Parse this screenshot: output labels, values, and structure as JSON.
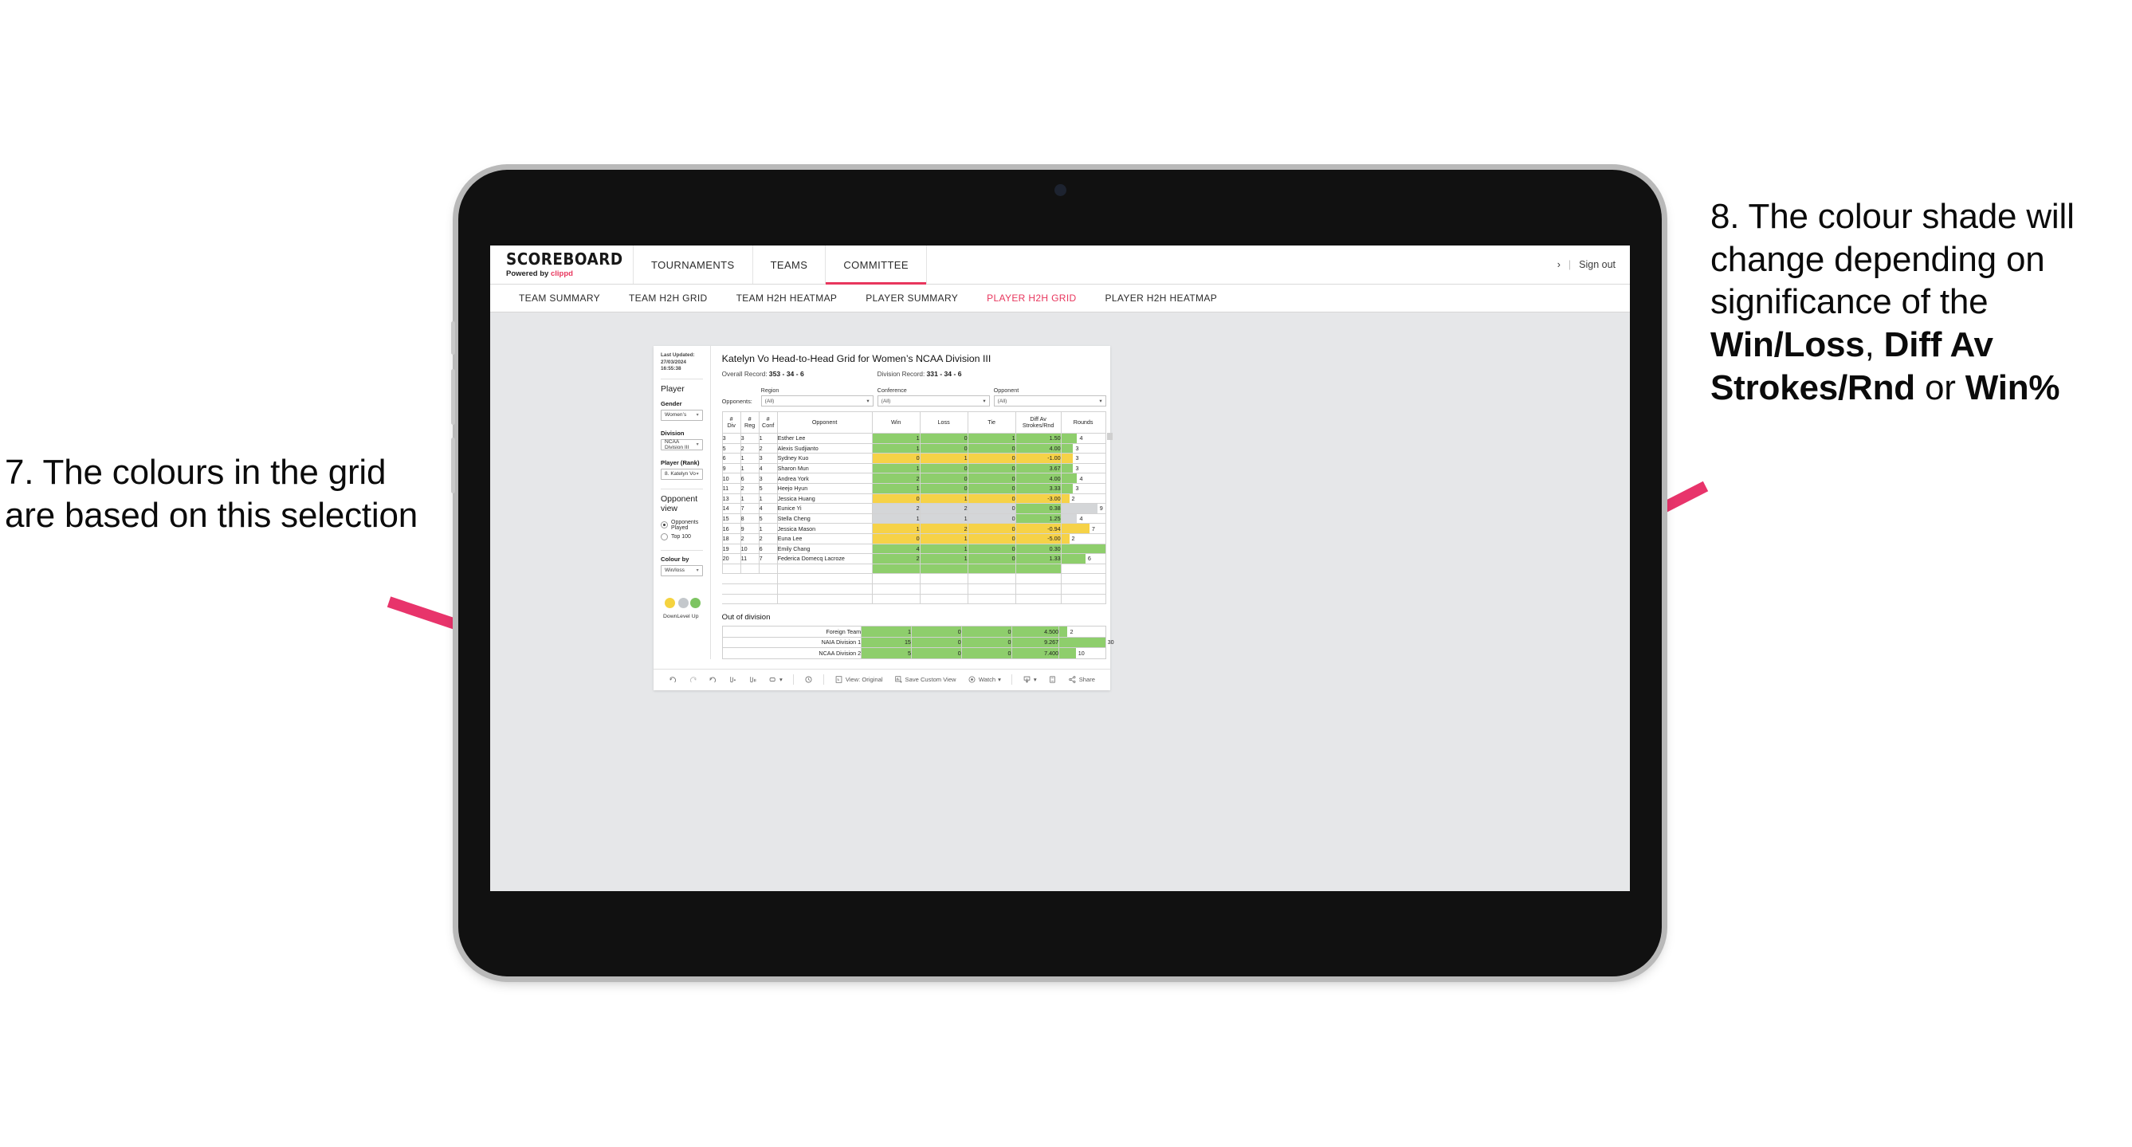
{
  "annotations": {
    "left": {
      "id": "annot-7",
      "text": "7. The colours in the grid are based on this selection"
    },
    "right": {
      "id": "annot-8",
      "prefix": "8. The colour shade will change depending on significance of the ",
      "b1": "Win/Loss",
      "mid1": ", ",
      "b2": "Diff Av Strokes/Rnd",
      "mid2": " or ",
      "b3": "Win%"
    },
    "arrow_color": "#e8346b"
  },
  "app": {
    "logo": {
      "main": "SCOREBOARD",
      "powered": "Powered by ",
      "brand": "clippd"
    },
    "nav": [
      {
        "label": "TOURNAMENTS",
        "active": false
      },
      {
        "label": "TEAMS",
        "active": false
      },
      {
        "label": "COMMITTEE",
        "active": true
      }
    ],
    "header_right": {
      "chevron": "›",
      "sep": "|",
      "signout": "Sign out"
    },
    "subnav": [
      {
        "label": "TEAM SUMMARY",
        "active": false
      },
      {
        "label": "TEAM H2H GRID",
        "active": false
      },
      {
        "label": "TEAM H2H HEATMAP",
        "active": false
      },
      {
        "label": "PLAYER SUMMARY",
        "active": false
      },
      {
        "label": "PLAYER H2H GRID",
        "active": true
      },
      {
        "label": "PLAYER H2H HEATMAP",
        "active": false
      }
    ],
    "accent": "#e8365d"
  },
  "sidebar": {
    "last_updated": "Last Updated: 27/03/2024 16:55:38",
    "section_player": "Player",
    "gender": {
      "label": "Gender",
      "value": "Women’s"
    },
    "division": {
      "label": "Division",
      "value": "NCAA Division III"
    },
    "player_rank": {
      "label": "Player (Rank)",
      "value": "8. Katelyn Vo"
    },
    "opponent_view": {
      "label": "Opponent view",
      "options": [
        {
          "label": "Opponents Played",
          "selected": true
        },
        {
          "label": "Top 100",
          "selected": false
        }
      ]
    },
    "colour_by": {
      "label": "Colour by",
      "value": "Win/loss"
    },
    "legend": [
      {
        "label": "Down",
        "color": "#f5d33f"
      },
      {
        "label": "Level",
        "color": "#c4c8cc"
      },
      {
        "label": "Up",
        "color": "#7dc462"
      }
    ]
  },
  "main": {
    "title": "Katelyn Vo Head-to-Head Grid for Women’s NCAA Division III",
    "overall_record": {
      "label": "Overall Record: ",
      "value": "353 - 34 - 6"
    },
    "division_record": {
      "label": "Division Record: ",
      "value": "331 - 34 - 6"
    },
    "opponents_label": "Opponents:",
    "filters": [
      {
        "label": "Region",
        "value": "(All)"
      },
      {
        "label": "Conference",
        "value": "(All)"
      },
      {
        "label": "Opponent",
        "value": "(All)"
      }
    ],
    "columns": [
      {
        "l1": "#",
        "l2": "Div"
      },
      {
        "l1": "#",
        "l2": "Reg"
      },
      {
        "l1": "#",
        "l2": "Conf"
      },
      {
        "l1": "Opponent",
        "l2": ""
      },
      {
        "l1": "Win",
        "l2": ""
      },
      {
        "l1": "Loss",
        "l2": ""
      },
      {
        "l1": "Tie",
        "l2": ""
      },
      {
        "l1": "Diff Av",
        "l2": "Strokes/Rnd"
      },
      {
        "l1": "Rounds",
        "l2": ""
      }
    ],
    "rows": [
      {
        "div": "3",
        "reg": "3",
        "conf": "1",
        "opponent": "Esther Lee",
        "win": "1",
        "loss": "0",
        "tie": "1",
        "diff": "1.50",
        "rounds": "4",
        "rounds_pct": 36,
        "color": "#8ece6c"
      },
      {
        "div": "5",
        "reg": "2",
        "conf": "2",
        "opponent": "Alexis Sudjianto",
        "win": "1",
        "loss": "0",
        "tie": "0",
        "diff": "4.00",
        "rounds": "3",
        "rounds_pct": 27,
        "color": "#8ece6c"
      },
      {
        "div": "6",
        "reg": "1",
        "conf": "3",
        "opponent": "Sydney Kuo",
        "win": "0",
        "loss": "1",
        "tie": "0",
        "diff": "-1.00",
        "rounds": "3",
        "rounds_pct": 27,
        "color": "#f6d247"
      },
      {
        "div": "9",
        "reg": "1",
        "conf": "4",
        "opponent": "Sharon Mun",
        "win": "1",
        "loss": "0",
        "tie": "0",
        "diff": "3.67",
        "rounds": "3",
        "rounds_pct": 27,
        "color": "#8ece6c"
      },
      {
        "div": "10",
        "reg": "6",
        "conf": "3",
        "opponent": "Andrea York",
        "win": "2",
        "loss": "0",
        "tie": "0",
        "diff": "4.00",
        "rounds": "4",
        "rounds_pct": 36,
        "color": "#8ece6c"
      },
      {
        "div": "11",
        "reg": "2",
        "conf": "5",
        "opponent": "Heejo Hyun",
        "win": "1",
        "loss": "0",
        "tie": "0",
        "diff": "3.33",
        "rounds": "3",
        "rounds_pct": 27,
        "color": "#8ece6c"
      },
      {
        "div": "13",
        "reg": "1",
        "conf": "1",
        "opponent": "Jessica Huang",
        "win": "0",
        "loss": "1",
        "tie": "0",
        "diff": "-3.00",
        "rounds": "2",
        "rounds_pct": 18,
        "color": "#f6d247"
      },
      {
        "div": "14",
        "reg": "7",
        "conf": "4",
        "opponent": "Eunice Yi",
        "win": "2",
        "loss": "2",
        "tie": "0",
        "diff": "0.38",
        "rounds": "9",
        "rounds_pct": 82,
        "color": "#d4d6d8",
        "diff_color": "#8ece6c"
      },
      {
        "div": "15",
        "reg": "8",
        "conf": "5",
        "opponent": "Stella Cheng",
        "win": "1",
        "loss": "1",
        "tie": "0",
        "diff": "1.25",
        "rounds": "4",
        "rounds_pct": 36,
        "color": "#d4d6d8",
        "diff_color": "#8ece6c"
      },
      {
        "div": "16",
        "reg": "9",
        "conf": "1",
        "opponent": "Jessica Mason",
        "win": "1",
        "loss": "2",
        "tie": "0",
        "diff": "-0.94",
        "rounds": "7",
        "rounds_pct": 64,
        "color": "#f6d247"
      },
      {
        "div": "18",
        "reg": "2",
        "conf": "2",
        "opponent": "Euna Lee",
        "win": "0",
        "loss": "1",
        "tie": "0",
        "diff": "-5.00",
        "rounds": "2",
        "rounds_pct": 18,
        "color": "#f6d247"
      },
      {
        "div": "19",
        "reg": "10",
        "conf": "6",
        "opponent": "Emily Chang",
        "win": "4",
        "loss": "1",
        "tie": "0",
        "diff": "0.30",
        "rounds": "11",
        "rounds_pct": 100,
        "color": "#8ece6c"
      },
      {
        "div": "20",
        "reg": "11",
        "conf": "7",
        "opponent": "Federica Domecq Lacroze",
        "win": "2",
        "loss": "1",
        "tie": "0",
        "diff": "1.33",
        "rounds": "6",
        "rounds_pct": 55,
        "color": "#8ece6c"
      }
    ],
    "out_of_division": {
      "title": "Out of division",
      "rows": [
        {
          "label": "Foreign Team",
          "win": "1",
          "loss": "0",
          "tie": "0",
          "diff": "4.500",
          "rounds": "2",
          "rounds_pct": 18,
          "color": "#8ece6c"
        },
        {
          "label": "NAIA Division 1",
          "win": "15",
          "loss": "0",
          "tie": "0",
          "diff": "9.267",
          "rounds": "30",
          "rounds_pct": 100,
          "color": "#8ece6c"
        },
        {
          "label": "NCAA Division 2",
          "win": "5",
          "loss": "0",
          "tie": "0",
          "diff": "7.400",
          "rounds": "10",
          "rounds_pct": 36,
          "color": "#8ece6c"
        }
      ]
    }
  },
  "toolbar": {
    "items": [
      {
        "name": "undo",
        "label": ""
      },
      {
        "name": "redo",
        "label": ""
      },
      {
        "name": "revert",
        "label": ""
      },
      {
        "name": "refresh-add",
        "label": ""
      },
      {
        "name": "pause",
        "label": ""
      },
      {
        "name": "fit",
        "label": "",
        "caret": "▾"
      },
      {
        "name": "history",
        "label": ""
      },
      {
        "name": "view-original",
        "label": "View: Original"
      },
      {
        "name": "save-custom-view",
        "label": "Save Custom View"
      },
      {
        "name": "watch",
        "label": "Watch",
        "caret": "▾"
      },
      {
        "name": "download",
        "label": "",
        "caret": "▾"
      },
      {
        "name": "fullscreen",
        "label": ""
      },
      {
        "name": "share",
        "label": "Share"
      }
    ]
  }
}
